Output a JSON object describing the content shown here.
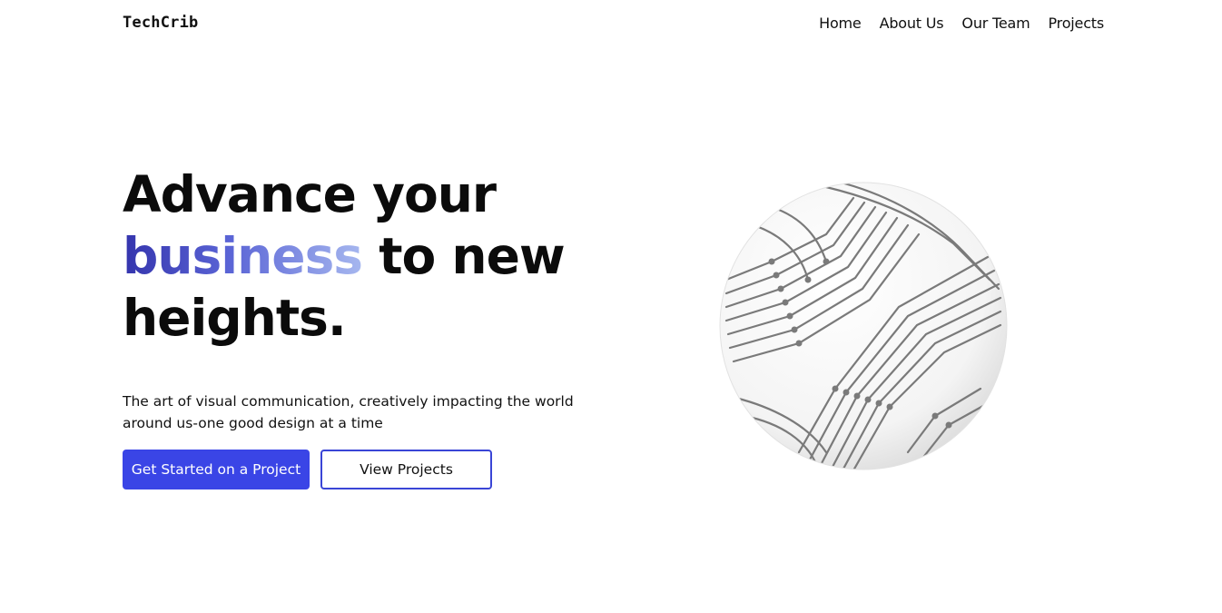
{
  "header": {
    "logo": "TechCrib",
    "nav": [
      "Home",
      "About Us",
      "Our Team",
      "Projects"
    ]
  },
  "hero": {
    "line1": "Advance your",
    "highlight": "business",
    "line2_rest": " to new",
    "line3": "heights.",
    "subtitle": "The art of visual communication, creatively impacting the world around us-one good design at a time",
    "primary_button": "Get Started on a Project",
    "secondary_button": "View Projects"
  },
  "colors": {
    "accent": "#3a45e6",
    "gradient_start": "#3434ad",
    "gradient_end": "#a6b7ef",
    "circuit": "#7a7a7a"
  },
  "icons": {
    "illustration": "circuit-globe-icon"
  }
}
